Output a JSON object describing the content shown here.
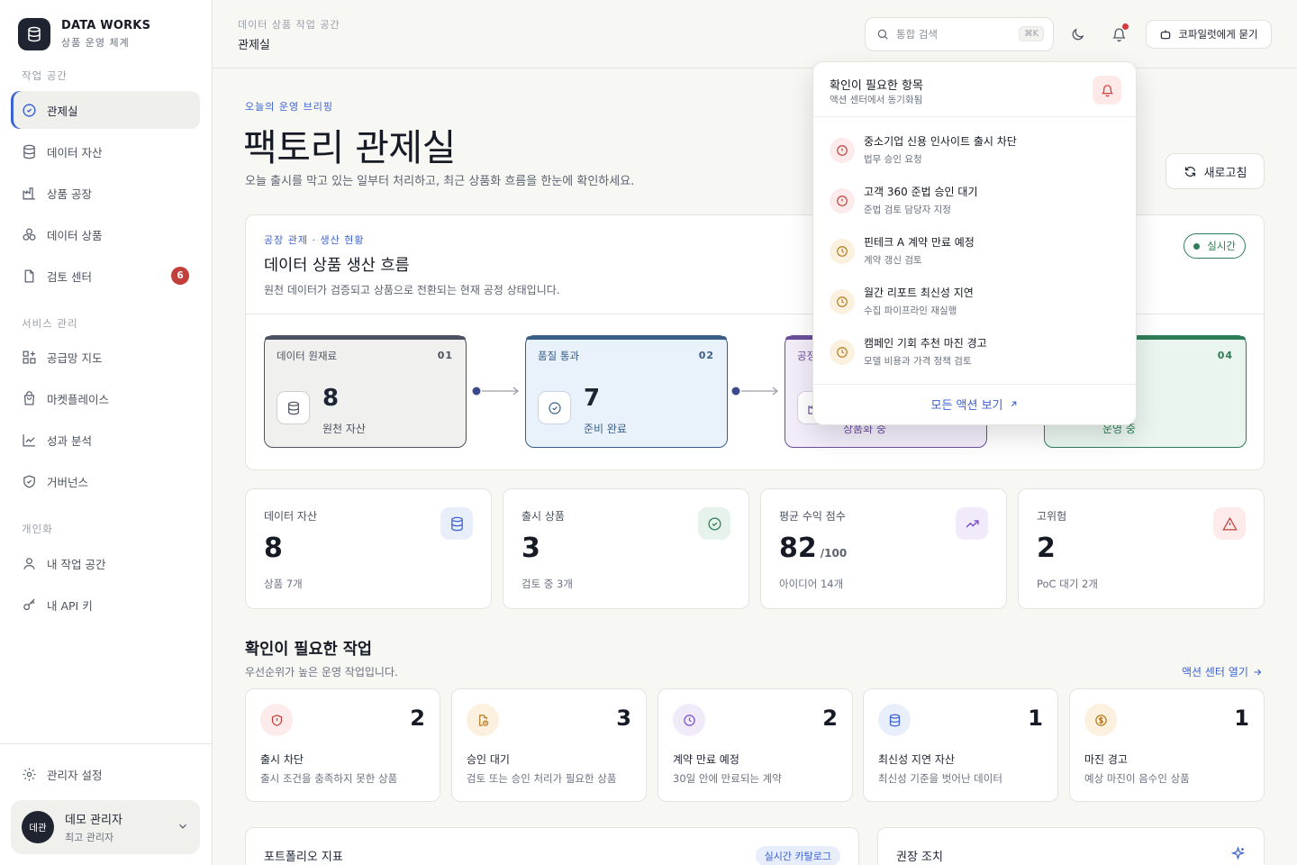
{
  "brand": {
    "name": "DATA WORKS",
    "subtitle": "상품 운영 체계"
  },
  "sidebar": {
    "section_workspace": "작업 공간",
    "section_service": "서비스 관리",
    "section_personal": "개인화",
    "items": [
      {
        "label": "관제실",
        "icon": "target-icon",
        "active": true
      },
      {
        "label": "데이터 자산",
        "icon": "database-icon"
      },
      {
        "label": "상품 공장",
        "icon": "factory-icon"
      },
      {
        "label": "데이터 상품",
        "icon": "boxes-icon"
      },
      {
        "label": "검토 센터",
        "icon": "document-icon",
        "badge": "6"
      },
      {
        "label": "공급망 지도",
        "icon": "grid-plus-icon"
      },
      {
        "label": "마켓플레이스",
        "icon": "shopping-bag-icon"
      },
      {
        "label": "성과 분석",
        "icon": "trend-icon"
      },
      {
        "label": "거버넌스",
        "icon": "shield-icon"
      },
      {
        "label": "내 작업 공간",
        "icon": "user-icon"
      },
      {
        "label": "내 API 키",
        "icon": "key-icon"
      }
    ],
    "admin_settings": "관리자 설정",
    "user": {
      "avatar": "데관",
      "name": "데모 관리자",
      "role": "최고 관리자"
    }
  },
  "topbar": {
    "breadcrumb_top": "데이터 상품 작업 공간",
    "breadcrumb_main": "관제실",
    "search_placeholder": "통합 검색",
    "search_shortcut": "⌘K",
    "copilot_label": "코파일럿에게 묻기"
  },
  "hero": {
    "eyebrow": "오늘의 운영 브리핑",
    "title": "팩토리 관제실",
    "description": "오늘 출시를 막고 있는 일부터 처리하고, 최근 상품화 흐름을 한눈에 확인하세요.",
    "refresh_label": "새로고침"
  },
  "flow": {
    "eyebrow": "공장 관제 · 생산 현황",
    "title": "데이터 상품 생산 흐름",
    "description": "원천 데이터가 검증되고 상품으로 전환되는 현재 공정 상태입니다.",
    "live_label": "실시간",
    "stages": [
      {
        "label": "데이터 원재료",
        "num": "01",
        "value": "8",
        "sub": "원천 자산",
        "color": "#4b5260"
      },
      {
        "label": "품질 통과",
        "num": "02",
        "value": "7",
        "sub": "준비 완료",
        "color": "#3a5f86"
      },
      {
        "label": "공정",
        "num": "03",
        "value": "",
        "sub": "상품화 중",
        "color": "#6b4e9b"
      },
      {
        "label": "",
        "num": "04",
        "value": "",
        "sub": "운영 중",
        "color": "#2f7d57"
      }
    ]
  },
  "stats": [
    {
      "label": "데이터 자산",
      "value": "8",
      "unit": "",
      "sub": "상품 7개",
      "icon": "database-icon",
      "color": "#3b63d1",
      "bg": "#e9eefb"
    },
    {
      "label": "출시 상품",
      "value": "3",
      "unit": "",
      "sub": "검토 중 3개",
      "icon": "check-circle-icon",
      "color": "#2f7d57",
      "bg": "#e6f3ec"
    },
    {
      "label": "평균 수익 점수",
      "value": "82",
      "unit": "/100",
      "sub": "아이디어 14개",
      "icon": "trend-up-icon",
      "color": "#7b4fc9",
      "bg": "#f0eafb"
    },
    {
      "label": "고위험",
      "value": "2",
      "unit": "",
      "sub": "PoC 대기 2개",
      "icon": "alert-triangle-icon",
      "color": "#c2403b",
      "bg": "#fcebea"
    }
  ],
  "tasks_section": {
    "title": "확인이 필요한 작업",
    "description": "우선순위가 높은 운영 작업입니다.",
    "link_label": "액션 센터 열기"
  },
  "tasks": [
    {
      "title": "출시 차단",
      "desc": "출시 조건을 충족하지 못한 상품",
      "count": "2",
      "icon": "shield-alert-icon",
      "color": "#c2403b",
      "bg": "#fcebea"
    },
    {
      "title": "승인 대기",
      "desc": "검토 또는 승인 처리가 필요한 상품",
      "count": "3",
      "icon": "file-clock-icon",
      "color": "#b7791f",
      "bg": "#fbf1de"
    },
    {
      "title": "계약 만료 예정",
      "desc": "30일 안에 만료되는 계약",
      "count": "2",
      "icon": "clock-icon",
      "color": "#7b4fc9",
      "bg": "#f0eafb"
    },
    {
      "title": "최신성 지연 자산",
      "desc": "최신성 기준을 벗어난 데이터",
      "count": "1",
      "icon": "database-icon",
      "color": "#3b63d1",
      "bg": "#e9eefb"
    },
    {
      "title": "마진 경고",
      "desc": "예상 마진이 음수인 상품",
      "count": "1",
      "icon": "dollar-icon",
      "color": "#b7791f",
      "bg": "#fbf1de"
    }
  ],
  "bottom": {
    "portfolio_title": "포트폴리오 지표",
    "portfolio_pill": "실시간 카탈로그",
    "actions_title": "권장 조치"
  },
  "notifications": {
    "title": "확인이 필요한 항목",
    "subtitle": "액션 센터에서 동기화됨",
    "items": [
      {
        "title": "중소기업 신용 인사이트 출시 차단",
        "sub": "법무 승인 요청",
        "kind": "alert",
        "color": "#c2403b",
        "bg": "#fcebea"
      },
      {
        "title": "고객 360 준법 승인 대기",
        "sub": "준법 검토 담당자 지정",
        "kind": "alert",
        "color": "#c2403b",
        "bg": "#fcebea"
      },
      {
        "title": "핀테크 A 계약 만료 예정",
        "sub": "계약 갱신 검토",
        "kind": "clock",
        "color": "#b7791f",
        "bg": "#fbf1de"
      },
      {
        "title": "월간 리포트 최신성 지연",
        "sub": "수집 파이프라인 재실행",
        "kind": "clock",
        "color": "#b7791f",
        "bg": "#fbf1de"
      },
      {
        "title": "캠페인 기회 추천 마진 경고",
        "sub": "모델 비용과 가격 정책 검토",
        "kind": "clock",
        "color": "#b7791f",
        "bg": "#fbf1de"
      }
    ],
    "footer_label": "모든 액션 보기"
  }
}
